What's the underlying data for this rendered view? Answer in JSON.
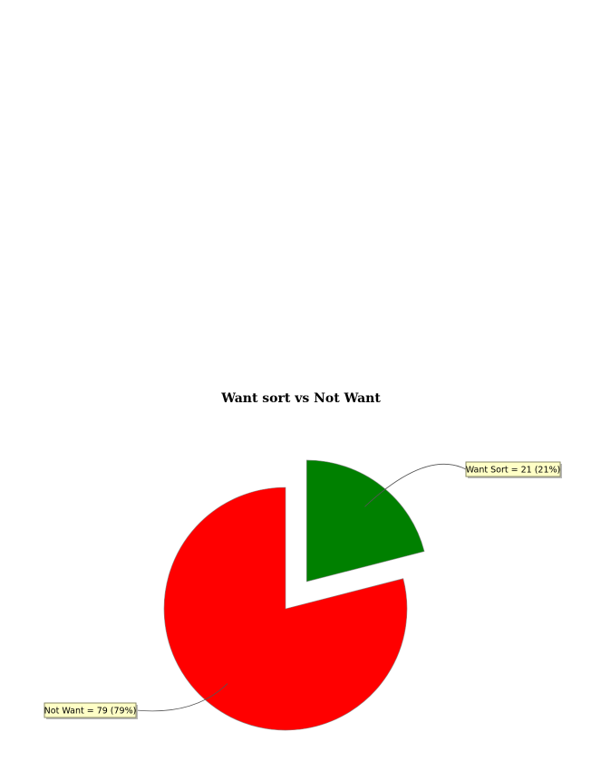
{
  "chart_data": {
    "type": "pie",
    "title": "Want sort vs Not Want",
    "slices": [
      {
        "label": "Want Sort",
        "value": 21,
        "percent": 21,
        "color": "#008000",
        "display": "Want Sort = 21 (21%)",
        "exploded": true
      },
      {
        "label": "Not Want",
        "value": 79,
        "percent": 79,
        "color": "#ff0000",
        "display": "Not Want = 79 (79%)",
        "exploded": false
      }
    ],
    "legend": "none",
    "label_style": "callout"
  }
}
